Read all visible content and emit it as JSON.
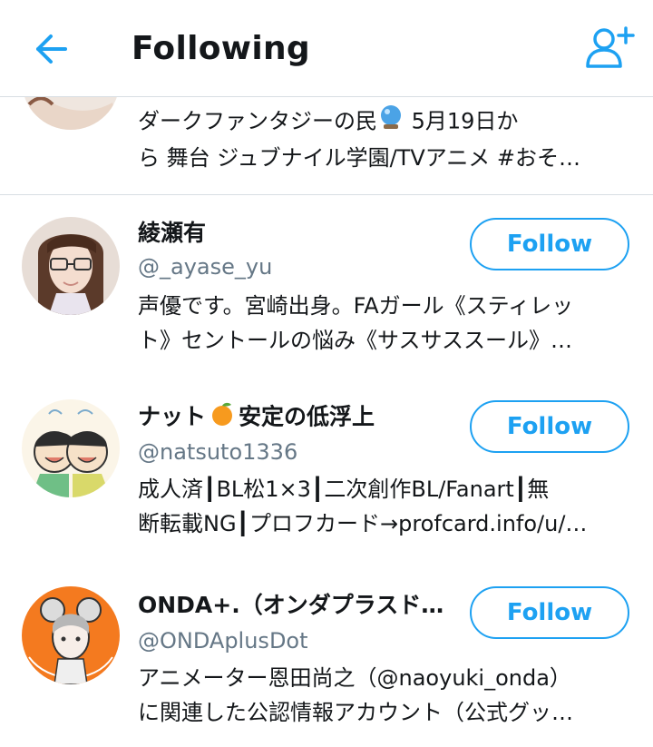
{
  "header": {
    "title": "Following"
  },
  "users": [
    {
      "name": "",
      "handle": "",
      "bio_line1": "ダークファンタジーの民",
      "bio_line1b": " 5月19日か",
      "bio_line2": "ら 舞台 ジュブナイル学園/TVアニメ #おそ…",
      "emoji": "crystal-ball"
    },
    {
      "name": "綾瀬有",
      "handle": "@_ayase_yu",
      "bio_line1": "声優です。宮崎出身。FAガール《スティレッ",
      "bio_line2": "ト》セントールの悩み《サスサススール》…",
      "follow_label": "Follow"
    },
    {
      "name_part1": "ナット",
      "name_part2": "安定の低浮上",
      "emoji": "tangerine",
      "handle": "@natsuto1336",
      "bio_line1": "成人済┃BL松1×3┃二次創作BL/Fanart┃無",
      "bio_line2": "断転載NG┃プロフカード→profcard.info/u/…",
      "follow_label": "Follow"
    },
    {
      "name": "ONDA+.（オンダプラスドッ…",
      "handle": "@ONDAplusDot",
      "bio_line1": "アニメーター恩田尚之（@naoyuki_onda）",
      "bio_line2": "に関連した公認情報アカウント（公式グッ…",
      "follow_label": "Follow"
    }
  ],
  "colors": {
    "accent": "#1da1f2",
    "secondary_text": "#657786",
    "divider": "#d8dee3"
  }
}
